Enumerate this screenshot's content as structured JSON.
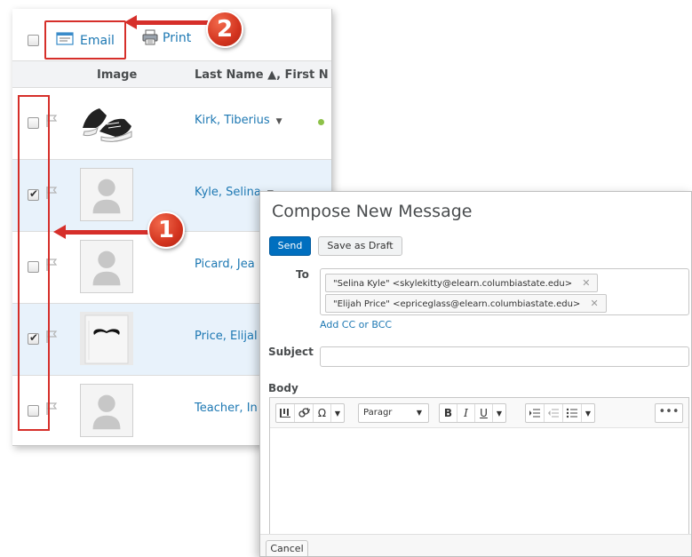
{
  "toolbar": {
    "email_label": "Email",
    "print_label": "Print"
  },
  "table": {
    "headers": {
      "image": "Image",
      "name": "Last Name ▲, First N"
    },
    "rows": [
      {
        "name": "Kirk, Tiberius",
        "checked": false,
        "photo": "sneakers"
      },
      {
        "name": "Kyle, Selina",
        "checked": true,
        "photo": "placeholder"
      },
      {
        "name": "Picard, Jea",
        "checked": false,
        "photo": "placeholder"
      },
      {
        "name": "Price, Elijal",
        "checked": true,
        "photo": "mustache"
      },
      {
        "name": "Teacher, In",
        "checked": false,
        "photo": "placeholder"
      }
    ],
    "dropdown_caret": "▼"
  },
  "callouts": {
    "one": "1",
    "two": "2"
  },
  "compose": {
    "title": "Compose New Message",
    "send_label": "Send",
    "draft_label": "Save as Draft",
    "to_label": "To",
    "recipients": [
      "\"Selina Kyle\" <skylekitty@elearn.columbiastate.edu>",
      "\"Elijah Price\" <epriceglass@elearn.columbiastate.edu>"
    ],
    "remove_symbol": "✕",
    "add_cc_label": "Add CC or BCC",
    "subject_label": "Subject",
    "subject_value": "",
    "body_label": "Body",
    "format_select": "Paragr",
    "cancel_label": "Cancel"
  },
  "colors": {
    "accent_red": "#d62f2a",
    "link_blue": "#1d78b3",
    "send_blue": "#006fbf",
    "selected_row": "#e8f2fb",
    "online_green": "#8dc149"
  }
}
